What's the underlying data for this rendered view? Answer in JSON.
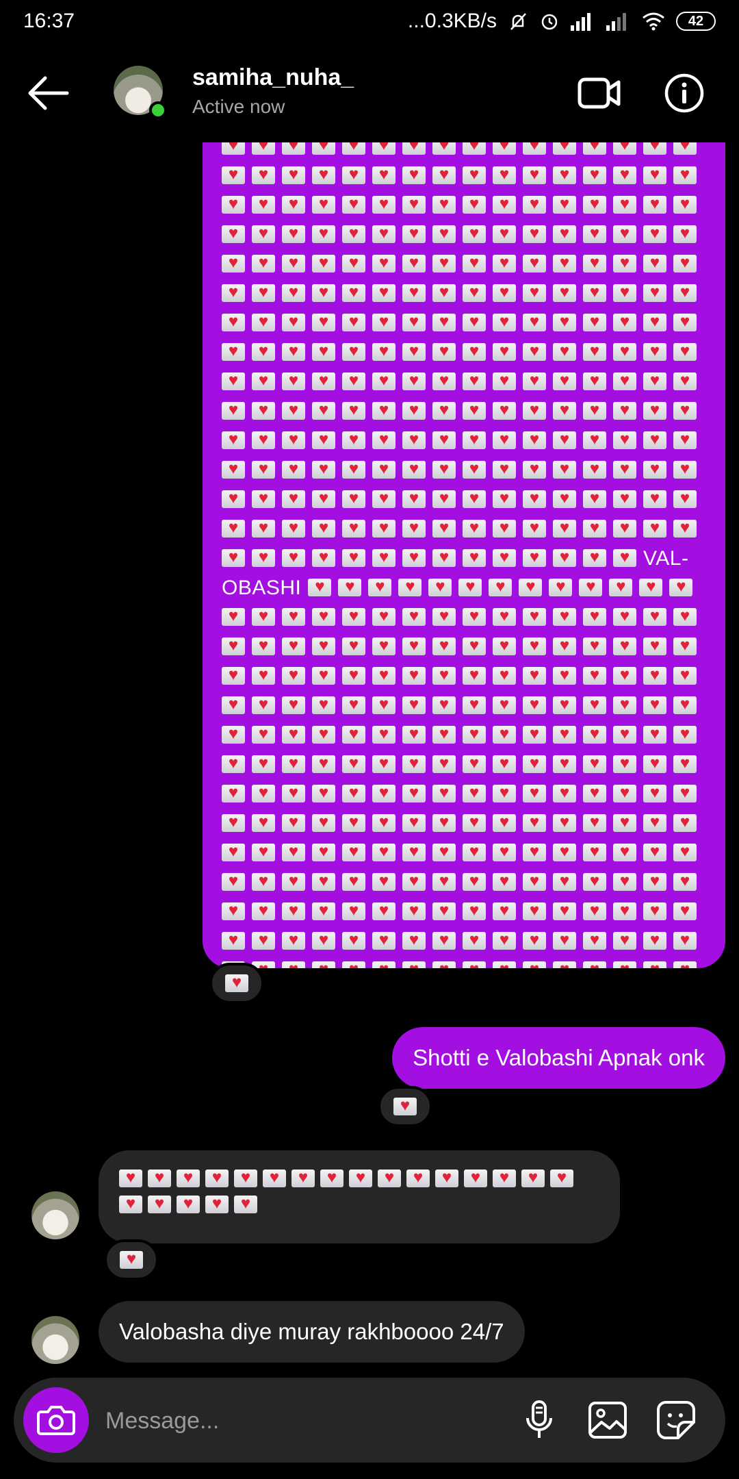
{
  "status_bar": {
    "time": "16:37",
    "network_speed": "...0.3KB/s",
    "battery": "42"
  },
  "header": {
    "username": "samiha_nuha_",
    "status": "Active now"
  },
  "conversation": {
    "big_message": {
      "rows_before": 14,
      "inline_envelopes_before_text": 14,
      "text_line1": "VAL-",
      "text_line2": "OBASHI",
      "inline_envelopes_after_text": 13,
      "rows_after": 13,
      "reaction": "envelope-heart"
    },
    "sent_message": {
      "text": "Shotti e Valobashi Apnak onk",
      "reaction": "envelope-heart"
    },
    "received_envelopes": {
      "line1_count": 16,
      "line2_count": 5,
      "reaction": "envelope-heart"
    },
    "received_message": {
      "text": "Valobasha diye muray rakhboooo 24/7"
    }
  },
  "composer": {
    "placeholder": "Message...",
    "icons": [
      "camera-icon",
      "microphone-icon",
      "gallery-icon",
      "sticker-icon"
    ]
  },
  "colors": {
    "accent": "#a20fe0",
    "bubble_received": "#262626",
    "online": "#3ad03a"
  }
}
